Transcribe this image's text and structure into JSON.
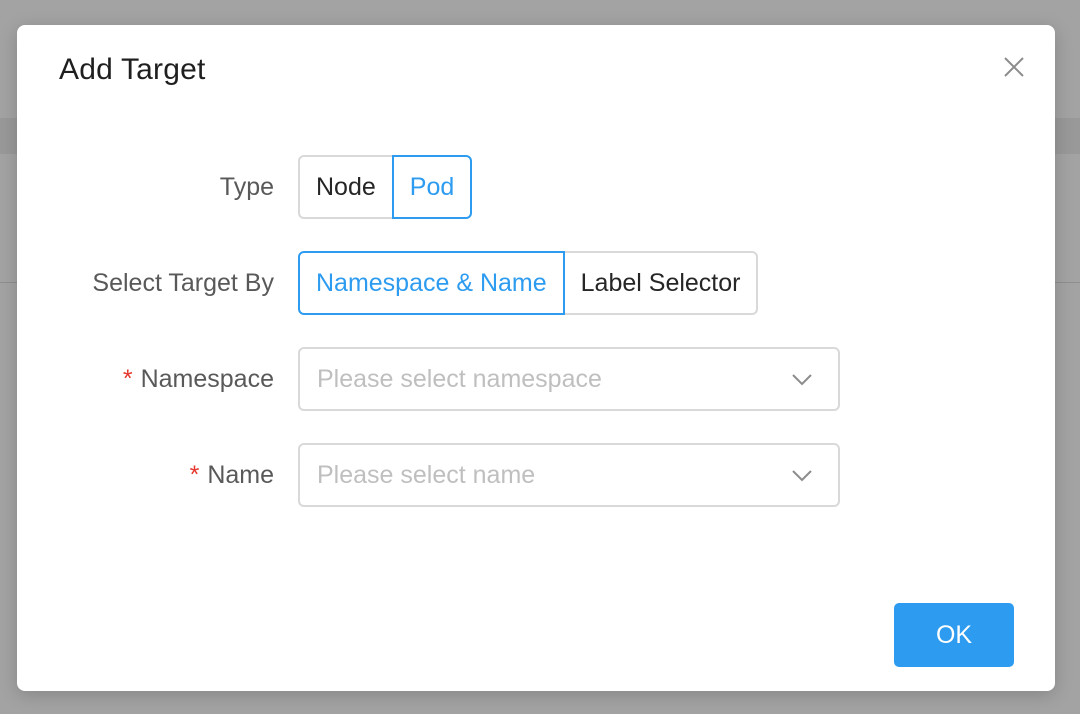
{
  "modal": {
    "title": "Add Target",
    "close_icon": "close-icon"
  },
  "form": {
    "type": {
      "label": "Type",
      "options": [
        "Node",
        "Pod"
      ],
      "selected": "Pod"
    },
    "select_target_by": {
      "label": "Select Target By",
      "options": [
        "Namespace & Name",
        "Label Selector"
      ],
      "selected": "Namespace & Name"
    },
    "namespace": {
      "required_mark": "*",
      "label": "Namespace",
      "placeholder": "Please select namespace",
      "arrow_icon": "chevron-down-icon"
    },
    "name": {
      "required_mark": "*",
      "label": "Name",
      "placeholder": "Please select name",
      "arrow_icon": "chevron-down-icon"
    }
  },
  "footer": {
    "ok_label": "OK"
  },
  "colors": {
    "accent": "#2d9cf0",
    "required": "#e5372e",
    "border": "#d9d9d9",
    "placeholder": "#bfbfbf"
  }
}
